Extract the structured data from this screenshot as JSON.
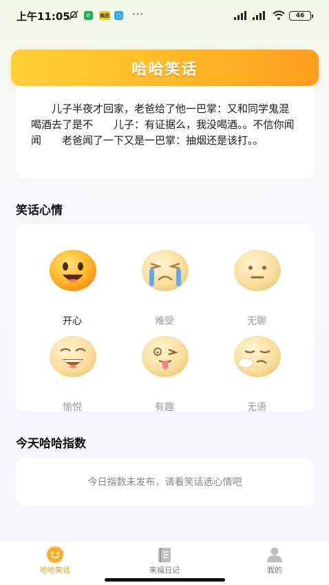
{
  "status_bar": {
    "time": "上午11:05",
    "battery": "46",
    "badge_label": "美团"
  },
  "banner": {
    "title": "哈哈笑话"
  },
  "joke": {
    "text": "儿子半夜才回家，老爸给了他一巴掌：又和同学鬼混喝酒去了是不　　儿子：有证据么，我没喝酒。。不信你闻闻　　老爸闻了一下又是一巴掌：抽烟还是该打。。"
  },
  "mood_section": {
    "title": "笑话心情",
    "moods": [
      {
        "label": "开心",
        "icon": "happy-face-icon",
        "active": true
      },
      {
        "label": "难受",
        "icon": "crying-face-icon",
        "active": false
      },
      {
        "label": "无聊",
        "icon": "bored-face-icon",
        "active": false
      },
      {
        "label": "愉悦",
        "icon": "laughing-face-icon",
        "active": false
      },
      {
        "label": "有趣",
        "icon": "winking-tongue-face-icon",
        "active": false
      },
      {
        "label": "无语",
        "icon": "speechless-face-icon",
        "active": false
      }
    ]
  },
  "index_section": {
    "title": "今天哈哈指数",
    "empty_text": "今日指数未发布，请看笑话选心情吧"
  },
  "tabbar": {
    "tabs": [
      {
        "label": "哈哈笑话",
        "icon": "smile-icon",
        "active": true
      },
      {
        "label": "来福日记",
        "icon": "diary-icon",
        "active": false
      },
      {
        "label": "我的",
        "icon": "user-icon",
        "active": false
      }
    ]
  },
  "colors": {
    "accent": "#f39b1a",
    "banner_start": "#ffcf37",
    "banner_end": "#ff9e1e"
  }
}
